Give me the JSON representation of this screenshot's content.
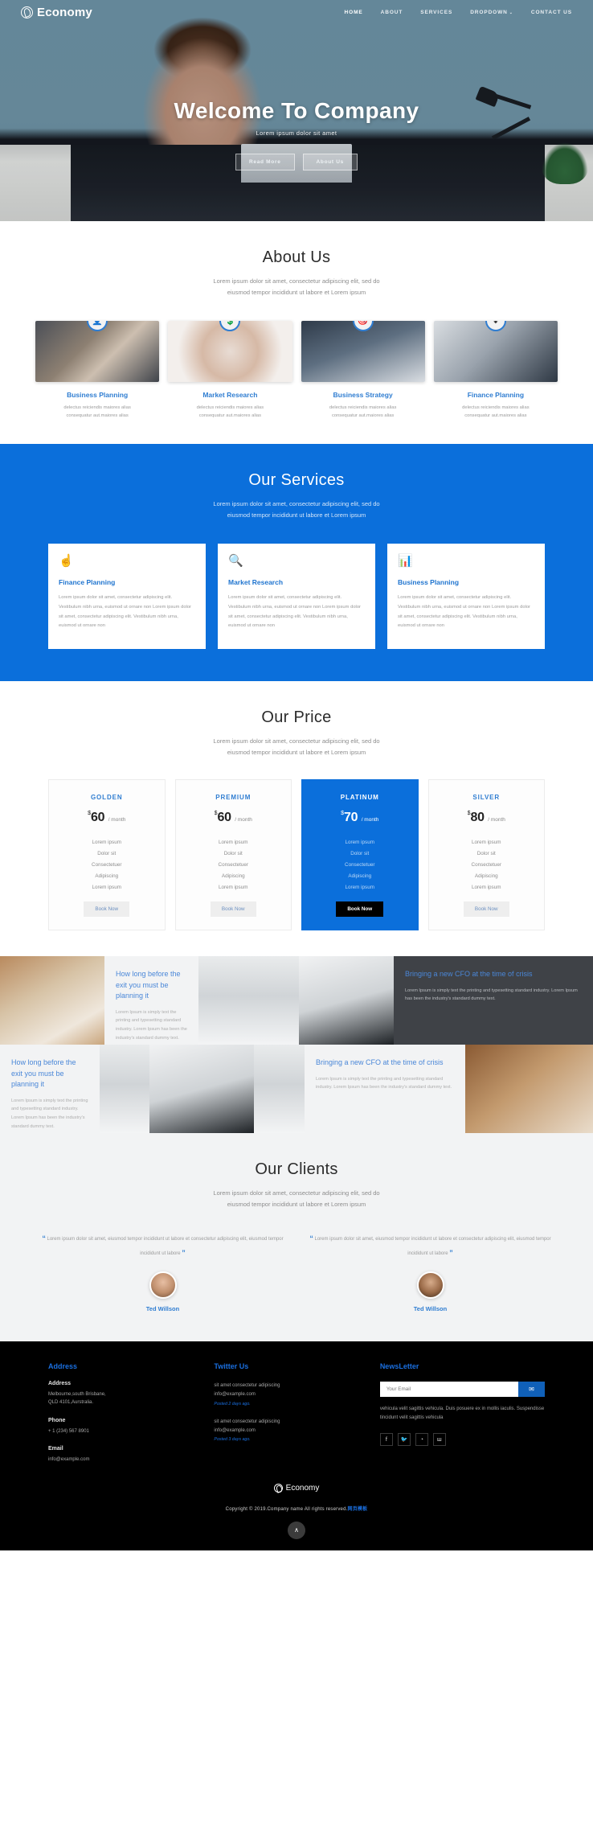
{
  "brand": {
    "name": "Economy",
    "icon": "globe-icon"
  },
  "nav": {
    "items": [
      {
        "label": "HOME",
        "active": true
      },
      {
        "label": "ABOUT",
        "active": false
      },
      {
        "label": "SERVICES",
        "active": false
      },
      {
        "label": "DROPDOWN",
        "active": false,
        "caret": "⌄"
      },
      {
        "label": "CONTACT US",
        "active": false
      }
    ]
  },
  "hero": {
    "title": "Welcome To Company",
    "subtitle": "Lorem ipsum dolor sit amet",
    "primary_button": "Read More",
    "secondary_button": "About Us"
  },
  "about": {
    "title": "About Us",
    "subtitle_line1": "Lorem ipsum dolor sit amet, consectetur adipiscing elit, sed do",
    "subtitle_line2": "eiusmod tempor incididunt ut labore et Lorem ipsum",
    "cards": [
      {
        "name": "Business Planning",
        "desc_line1": "delectus reiciendis maiores alias",
        "desc_line2": "consequatur aut.maiores alias",
        "badge": "user-icon",
        "glyph": "👤"
      },
      {
        "name": "Market Research",
        "desc_line1": "delectus reiciendis maiores alias",
        "desc_line2": "consequatur aut.maiores alias",
        "badge": "dollar-icon",
        "glyph": "💲"
      },
      {
        "name": "Business Strategy",
        "desc_line1": "delectus reiciendis maiores alias",
        "desc_line2": "consequatur aut.maiores alias",
        "badge": "bulb-icon",
        "glyph": "🎯"
      },
      {
        "name": "Finance Planning",
        "desc_line1": "delectus reiciendis maiores alias",
        "desc_line2": "consequatur aut.maiores alias",
        "badge": "arrow-down-icon",
        "glyph": "⬇"
      }
    ]
  },
  "services": {
    "title": "Our Services",
    "subtitle_line1": "Lorem ipsum dolor sit amet, consectetur adipiscing elit, sed do",
    "subtitle_line2": "eiusmod tempor incididunt ut labore et Lorem ipsum",
    "accent": "#0b6fdb",
    "cards": [
      {
        "icon": "hand-pointing-icon",
        "glyph": "☝",
        "title": "Finance Planning",
        "text": "Lorem ipsum dolor sit amet, consectetur adipiscing elit. Vestibulum nibh urna, euismod ut ornare non Lorem ipsum dolor sit amet, consectetur adipiscing elit. Vestibulum nibh urna, euismod ut ornare non"
      },
      {
        "icon": "search-icon",
        "glyph": "🔍",
        "title": "Market Research",
        "text": "Lorem ipsum dolor sit amet, consectetur adipiscing elit. Vestibulum nibh urna, euismod ut ornare non Lorem ipsum dolor sit amet, consectetur adipiscing elit. Vestibulum nibh urna, euismod ut ornare non"
      },
      {
        "icon": "bar-chart-icon",
        "glyph": "📊",
        "title": "Business Planning",
        "text": "Lorem ipsum dolor sit amet, consectetur adipiscing elit. Vestibulum nibh urna, euismod ut ornare non Lorem ipsum dolor sit amet, consectetur adipiscing elit. Vestibulum nibh urna, euismod ut ornare non"
      }
    ]
  },
  "price": {
    "title": "Our Price",
    "subtitle_line1": "Lorem ipsum dolor sit amet, consectetur adipiscing elit, sed do",
    "subtitle_line2": "eiusmod tempor incididunt ut labore et Lorem ipsum",
    "plans": [
      {
        "name": "GOLDEN",
        "currency": "$",
        "amount": "60",
        "period": "/ month",
        "features": [
          "Lorem ipsum",
          "Dolor sit",
          "Consectetuer",
          "Adipiscing",
          "Lorem ipsum"
        ],
        "button": "Book Now",
        "featured": false
      },
      {
        "name": "PREMIUM",
        "currency": "$",
        "amount": "60",
        "period": "/ month",
        "features": [
          "Lorem ipsum",
          "Dolor sit",
          "Consectetuer",
          "Adipiscing",
          "Lorem ipsum"
        ],
        "button": "Book Now",
        "featured": false
      },
      {
        "name": "PLATINUM",
        "currency": "$",
        "amount": "70",
        "period": "/ month",
        "features": [
          "Lorem ipsum",
          "Dolor sit",
          "Consectetuer",
          "Adipiscing",
          "Lorem ipsum"
        ],
        "button": "Book Now",
        "featured": true
      },
      {
        "name": "SILVER",
        "currency": "$",
        "amount": "80",
        "period": "/ month",
        "features": [
          "Lorem ipsum",
          "Dolor sit",
          "Consectetuer",
          "Adipiscing",
          "Lorem ipsum"
        ],
        "button": "Book Now",
        "featured": false
      }
    ]
  },
  "blog": {
    "post1": {
      "title": "How long before the exit you must be planning it",
      "text": "Lorem Ipsum is simply text the printing and typesetting standard industry. Lorem Ipsum has been the industry's standard dummy text."
    },
    "post2": {
      "title": "Bringing a new CFO at the time of crisis",
      "text": "Lorem Ipsum is simply text the printing and typesetting standard industry. Lorem Ipsum has been the industry's standard dummy text."
    },
    "post3": {
      "title": "How long before the exit you must be planning it",
      "text": "Lorem Ipsum is simply text the printing and typesetting standard industry. Lorem Ipsum has been the industry's standard dummy text."
    },
    "post4": {
      "title": "Bringing a new CFO at the time of crisis",
      "text": "Lorem Ipsum is simply text the printing and typesetting standard industry. Lorem Ipsum has been the industry's standard dummy text."
    }
  },
  "clients": {
    "title": "Our Clients",
    "subtitle_line1": "Lorem ipsum dolor sit amet, consectetur adipiscing elit, sed do",
    "subtitle_line2": "eiusmod tempor incididunt ut labore et Lorem ipsum",
    "items": [
      {
        "quote": "Lorem ipsum dolor sit amet, eiusmod tempor incididunt ut labore et consectetur adipiscing elit, eiusmod tempor incididunt ut labore",
        "name": "Ted Willson"
      },
      {
        "quote": "Lorem ipsum dolor sit amet, eiusmod tempor incididunt ut labore et consectetur adipiscing elit, eiusmod tempor incididunt ut labore",
        "name": "Ted Willson"
      }
    ],
    "quote_mark": "“",
    "quote_mark_end": "”"
  },
  "footer": {
    "address": {
      "heading": "Address",
      "address_label": "Address",
      "address_line1": "Melbourne,south Brisbane,",
      "address_line2": "QLD 4101,Aurstralia.",
      "phone_label": "Phone",
      "phone_value": "+ 1 (234) 567 8901",
      "email_label": "Email",
      "email_value": "info@example.com"
    },
    "twitter": {
      "heading": "Twitter Us",
      "tweets": [
        {
          "line1": "sit amet consectetur adipiscing",
          "line2": "info@example.com",
          "posted": "Posted 2 days ago."
        },
        {
          "line1": "sit amet consectetur adipiscing",
          "line2": "info@example.com",
          "posted": "Posted 3 days ago."
        }
      ]
    },
    "newsletter": {
      "heading": "NewsLetter",
      "email_placeholder": "Your Email",
      "email_value": "",
      "submit_icon": "envelope-icon",
      "submit_glyph": "✉",
      "text": "vehicula velit sagittis vehicula. Duis posuere ex in mollis iaculis. Suspendisse tincidunt velit sagittis vehicula",
      "socials": [
        {
          "name": "facebook-icon",
          "glyph": "f"
        },
        {
          "name": "twitter-icon",
          "glyph": "🐦"
        },
        {
          "name": "rss-icon",
          "glyph": "◔"
        },
        {
          "name": "vk-icon",
          "glyph": "ш"
        }
      ]
    },
    "bottom": {
      "brand": "Economy",
      "copyright": "Copyright © 2019.Company name All rights reserved.",
      "link": "网页模板",
      "to_top_glyph": "∧"
    }
  }
}
